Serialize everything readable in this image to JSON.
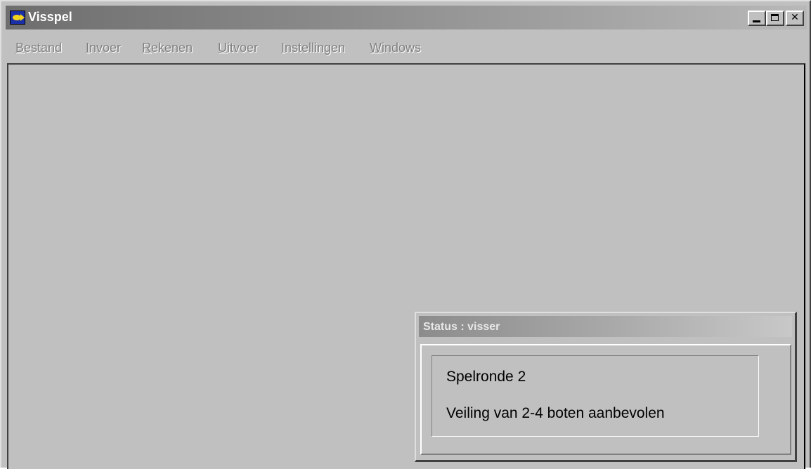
{
  "window": {
    "title": "Visspel",
    "icon": "fish-app-icon",
    "controls": {
      "minimize": "minimize-icon",
      "maximize": "maximize-icon",
      "close": "✕"
    }
  },
  "menubar": {
    "items": [
      {
        "label": "Bestand"
      },
      {
        "label": "Invoer"
      },
      {
        "label": "Rekenen"
      },
      {
        "label": "Uitvoer"
      },
      {
        "label": "Instellingen"
      },
      {
        "label": "Windows"
      }
    ]
  },
  "status_window": {
    "title": "Status : visser",
    "lines": [
      "Spelronde 2",
      "Veiling van 2-4 boten aanbevolen"
    ]
  },
  "colors": {
    "face": "#c0c0c0",
    "inactive_title": "#8a8a8a",
    "disabled_text": "#808080"
  }
}
